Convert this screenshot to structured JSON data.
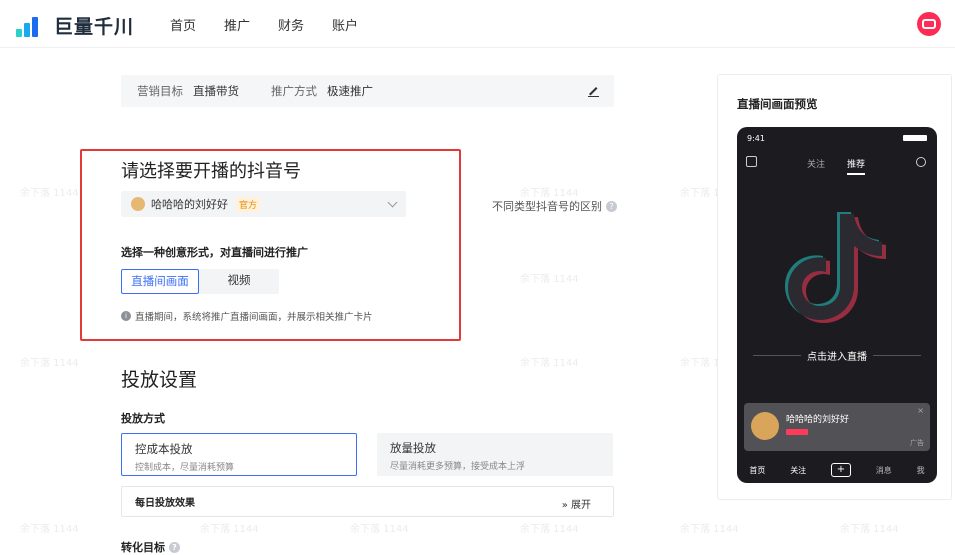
{
  "header": {
    "brand": "巨量千川",
    "nav": [
      "首页",
      "推广",
      "财务",
      "账户"
    ]
  },
  "summary": {
    "goal_key": "营销目标",
    "goal_val": "直播带货",
    "mode_key": "推广方式",
    "mode_val": "极速推广"
  },
  "account_section": {
    "title": "请选择要开播的抖音号",
    "account_name": "哈哈哈的刘好好",
    "account_tag": "官方",
    "help_text": "不同类型抖音号的区别",
    "creative_title": "选择一种创意形式，对直播间进行推广",
    "creative_options": [
      "直播间画面",
      "视频"
    ],
    "info_text": "直播期间，系统将推广直播间画面，并展示相关推广卡片"
  },
  "delivery": {
    "title": "投放设置",
    "method_label": "投放方式",
    "cards": [
      {
        "title": "控成本投放",
        "desc": "控制成本，尽量消耗预算"
      },
      {
        "title": "放量投放",
        "desc": "尽量消耗更多预算，接受成本上浮"
      }
    ],
    "daily_label": "每日投放效果",
    "expand_label": "展开",
    "conversion_label": "转化目标"
  },
  "preview": {
    "title": "直播间画面预览",
    "time": "9:41",
    "tabs": [
      "关注",
      "推荐"
    ],
    "live_text": "点击进入直播",
    "card_name": "哈哈哈的刘好好",
    "card_close": "×",
    "card_ad": "广告",
    "bottom": [
      "首页",
      "关注",
      "+",
      "消息",
      "我"
    ]
  },
  "watermark": "余下落 1144",
  "colors": {
    "accent": "#3c6ff5",
    "highlight": "#e53935",
    "brand_red": "#fe2c55"
  }
}
